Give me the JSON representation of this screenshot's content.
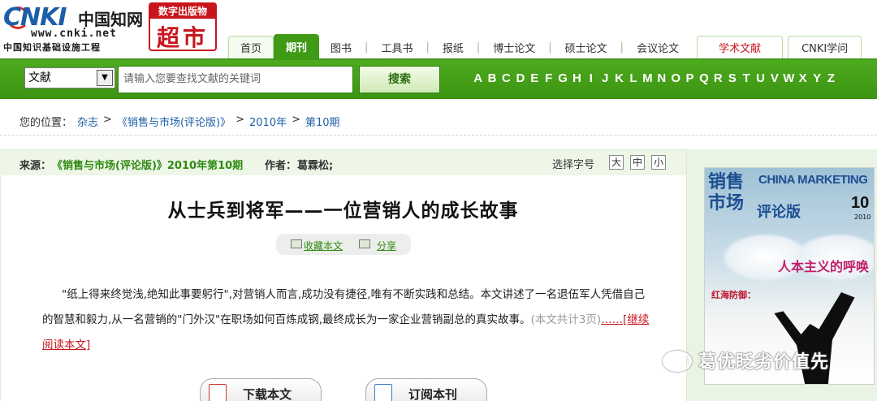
{
  "header": {
    "logo_text": "CNKI",
    "logo_cn": "中国知网",
    "logo_url": "www.cnki.net",
    "logo_sub": "中国知识基础设施工程",
    "market_top": "数字出版物",
    "market_big": "超市"
  },
  "nav": {
    "tabs": [
      "首页",
      "期刊",
      "图书",
      "工具书",
      "报纸",
      "博士论文",
      "硕士论文",
      "会议论文"
    ],
    "active": "期刊",
    "extra": [
      "学术文献",
      "CNKI学问"
    ]
  },
  "search": {
    "select_value": "文献",
    "placeholder": "请输入您要查找文献的关键词",
    "button": "搜索",
    "letters": [
      "A",
      "B",
      "C",
      "D",
      "E",
      "F",
      "G",
      "H",
      "I",
      "J",
      "K",
      "L",
      "M",
      "N",
      "O",
      "P",
      "Q",
      "R",
      "S",
      "T",
      "U",
      "V",
      "W",
      "X",
      "Y",
      "Z"
    ]
  },
  "breadcrumb": {
    "label": "您的位置：",
    "items": [
      "杂志",
      "《销售与市场(评论版)》",
      "2010年",
      "第10期"
    ],
    "sep": ">"
  },
  "meta": {
    "source_label": "来源：",
    "source": "《销售与市场(评论版)》2010年第10期",
    "author_label": "作者：",
    "author": "葛霖松;",
    "fontsize_label": "选择字号",
    "sizes": [
      "大",
      "中",
      "小"
    ]
  },
  "article": {
    "title": "从士兵到将军——一位营销人的成长故事",
    "favorite": "收藏本文",
    "share": "分享",
    "abstract": "\"纸上得来终觉浅,绝知此事要躬行\",对营销人而言,成功没有捷径,唯有不断实践和总结。本文讲述了一名退伍军人凭借自己的智慧和毅力,从一名营销的\"门外汉\"在职场如何百炼成钢,最终成长为一家企业营销副总的真实故事。",
    "page_count": "(本文共计3页)",
    "read_more": "……[继续阅读本文]",
    "download": "下载本文",
    "subscribe": "订阅本刊"
  },
  "cover": {
    "title_cn": "销售市场",
    "title_en": "CHINA MARKETING",
    "edition": "评论版",
    "issue": "10",
    "year": "2010",
    "headline": "人本主义的呼唤",
    "red_line": "红海防御："
  },
  "watermark": "葛优眨劣价值先"
}
